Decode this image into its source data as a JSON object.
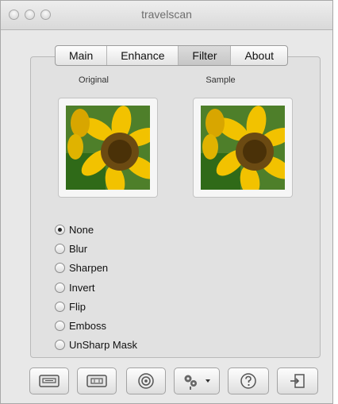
{
  "window": {
    "title": "travelscan"
  },
  "tabs": [
    {
      "label": "Main",
      "selected": false
    },
    {
      "label": "Enhance",
      "selected": false
    },
    {
      "label": "Filter",
      "selected": true
    },
    {
      "label": "About",
      "selected": false
    }
  ],
  "previews": {
    "original_label": "Original",
    "sample_label": "Sample"
  },
  "filters": {
    "selected": "None",
    "options": [
      "None",
      "Blur",
      "Sharpen",
      "Invert",
      "Flip",
      "Emboss",
      "UnSharp Mask"
    ]
  },
  "toolbar": {
    "buttons": [
      {
        "icon": "scanner-icon"
      },
      {
        "icon": "scanner-alt-icon"
      },
      {
        "icon": "camera-lens-icon"
      },
      {
        "icon": "settings-gear-icon",
        "has_menu": true
      },
      {
        "icon": "help-icon"
      },
      {
        "icon": "exit-icon"
      }
    ]
  },
  "colors": {
    "window_bg": "#e8e8e8",
    "sunflower_petal": "#f2c200",
    "sunflower_center": "#6b4a12",
    "leaf_green": "#3f7b1c"
  }
}
